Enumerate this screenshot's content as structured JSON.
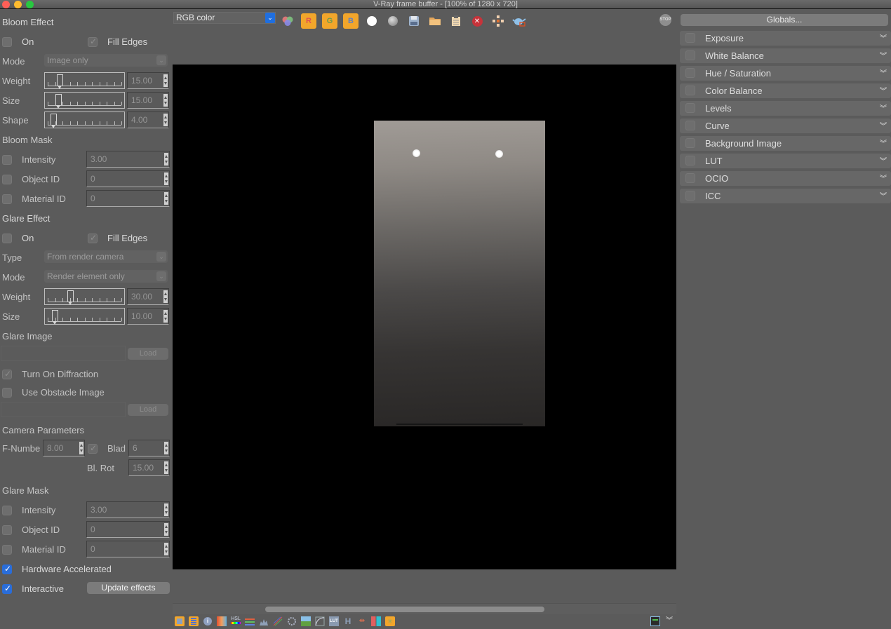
{
  "window": {
    "title": "V-Ray frame buffer - [100% of 1280 x 720]"
  },
  "toolbar": {
    "channel_select": "RGB color",
    "icons": [
      "color-wheel-icon",
      "red-channel-icon",
      "green-channel-icon",
      "blue-channel-icon",
      "white-circle-icon",
      "mono-sphere-icon",
      "save-icon",
      "open-folder-icon",
      "clipboard-icon",
      "clear-icon",
      "region-render-icon",
      "teapot-render-icon"
    ],
    "r_label": "R",
    "g_label": "G",
    "b_label": "B",
    "stop_label": "STOP"
  },
  "left_panel": {
    "bloom_effect": {
      "title": "Bloom Effect",
      "on_label": "On",
      "on_checked": false,
      "fill_edges_label": "Fill Edges",
      "fill_edges_checked": true,
      "mode_label": "Mode",
      "mode_value": "Image only",
      "weight_label": "Weight",
      "weight_value": "15.00",
      "size_label": "Size",
      "size_value": "15.00",
      "shape_label": "Shape",
      "shape_value": "4.00"
    },
    "bloom_mask": {
      "title": "Bloom Mask",
      "intensity_label": "Intensity",
      "intensity_value": "3.00",
      "object_id_label": "Object ID",
      "object_id_value": "0",
      "material_id_label": "Material ID",
      "material_id_value": "0"
    },
    "glare_effect": {
      "title": "Glare Effect",
      "on_label": "On",
      "on_checked": false,
      "fill_edges_label": "Fill Edges",
      "fill_edges_checked": true,
      "type_label": "Type",
      "type_value": "From render camera",
      "mode_label": "Mode",
      "mode_value": "Render element only",
      "weight_label": "Weight",
      "weight_value": "30.00",
      "size_label": "Size",
      "size_value": "10.00"
    },
    "glare_image": {
      "title": "Glare Image",
      "load_label": "Load",
      "diffraction_label": "Turn On Diffraction",
      "diffraction_checked": true,
      "obstacle_label": "Use Obstacle Image",
      "obstacle_checked": false,
      "load2_label": "Load"
    },
    "camera_parameters": {
      "title": "Camera Parameters",
      "fnumber_label": "F-Numbe",
      "fnumber_value": "8.00",
      "blades_label": "Blad",
      "blades_checked": true,
      "blades_value": "6",
      "blrot_label": "Bl. Rot",
      "blrot_value": "15.00"
    },
    "glare_mask": {
      "title": "Glare Mask",
      "intensity_label": "Intensity",
      "intensity_value": "3.00",
      "object_id_label": "Object ID",
      "object_id_value": "0",
      "material_id_label": "Material ID",
      "material_id_value": "0"
    },
    "hardware_accelerated_label": "Hardware Accelerated",
    "hardware_accelerated_checked": true,
    "interactive_label": "Interactive",
    "interactive_checked": true,
    "update_effects_label": "Update effects"
  },
  "right_panel": {
    "globals_label": "Globals...",
    "corrections": [
      {
        "label": "Exposure",
        "checked": false
      },
      {
        "label": "White Balance",
        "checked": false
      },
      {
        "label": "Hue / Saturation",
        "checked": false
      },
      {
        "label": "Color Balance",
        "checked": false
      },
      {
        "label": "Levels",
        "checked": false
      },
      {
        "label": "Curve",
        "checked": false
      },
      {
        "label": "Background Image",
        "checked": false
      },
      {
        "label": "LUT",
        "checked": false
      },
      {
        "label": "OCIO",
        "checked": false
      },
      {
        "label": "ICC",
        "checked": false
      }
    ]
  },
  "bottom_toolbar": {
    "icons": [
      "display-window-icon",
      "history-icon",
      "info-icon",
      "color-correction-icon",
      "hsl-icon",
      "layers-icon",
      "histogram-icon",
      "waveform-icon",
      "vectorscope-icon",
      "image-icon",
      "curve-icon",
      "lut-icon",
      "h-icon",
      "split-icon",
      "compare-icon",
      "lens-effects-icon"
    ],
    "lut_label": "LUT",
    "hsl_label": "HSL",
    "h_label": "H"
  }
}
